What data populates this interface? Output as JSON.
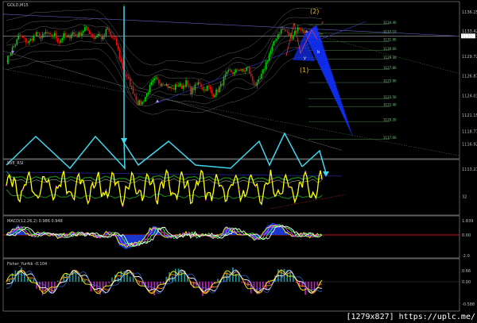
{
  "chart_data": [
    {
      "type": "candlestick",
      "title": "GOLD,M15",
      "ylim": [
        1115.0,
        1137.5
      ],
      "yticks": [
        "1136.25",
        "1133.42",
        "1132.71",
        "1129.72",
        "1126.87",
        "1124.01",
        "1121.15",
        "1118.77",
        "1116.92",
        "1113.27"
      ],
      "ohlc_path": [
        1129.0,
        1130.5,
        1131.5,
        1132.8,
        1132.2,
        1131.7,
        1132.5,
        1133.0,
        1132.4,
        1133.2,
        1132.6,
        1132.9,
        1131.8,
        1132.8,
        1132.2,
        1133.3,
        1132.7,
        1133.1,
        1133.9,
        1133.2,
        1132.4,
        1133.0,
        1132.2,
        1133.8,
        1132.5,
        1131.8,
        1129.2,
        1127.0,
        1126.0,
        1124.5,
        1122.9,
        1123.0,
        1124.2,
        1125.6,
        1126.4,
        1125.8,
        1126.0,
        1125.2,
        1124.9,
        1125.6,
        1125.3,
        1125.9,
        1124.6,
        1125.2,
        1126.0,
        1124.8,
        1125.3,
        1124.1,
        1124.6,
        1125.5,
        1126.9,
        1127.6,
        1127.2,
        1128.0,
        1127.4,
        1128.2,
        1126.3,
        1125.4,
        1126.5,
        1128.3,
        1130.1,
        1131.6,
        1133.0,
        1133.8,
        1133.2,
        1132.5,
        1133.6,
        1133.9,
        1133.1,
        1132.3,
        1133.4,
        1133.0,
        1132.7
      ],
      "marker_labels": [
        "(2)",
        "(1)",
        "a",
        "b",
        "y",
        "x"
      ],
      "series": [
        {
          "name": "bullish",
          "color": "#00d000"
        },
        {
          "name": "bearish",
          "color": "#e01010"
        },
        {
          "name": "zigzag",
          "color": "#40d8f0"
        },
        {
          "name": "harmonic",
          "color": "#1030ff"
        },
        {
          "name": "fib levels",
          "color": "#4a8a4a"
        }
      ]
    },
    {
      "type": "line",
      "title": "SVE_RSI",
      "yticks": [
        "",
        "32"
      ],
      "series": [
        {
          "name": "oscillator",
          "color": "#ffff00"
        }
      ]
    },
    {
      "type": "bar",
      "title": "MACD(12,26,2) 0.986 0.948",
      "yticks": [
        "1.839",
        "0.00",
        "-2.0"
      ],
      "series": [
        {
          "name": "histogram",
          "color": "#1a3ad8"
        },
        {
          "name": "signal",
          "color": "#ff2020"
        }
      ]
    },
    {
      "type": "bar",
      "title": "Fisher_Yur4ik -0.104",
      "yticks": [
        "0.66",
        "0.00",
        "-0.588"
      ],
      "series": [
        {
          "name": "positive",
          "color": "#1e9a9a"
        },
        {
          "name": "negative",
          "color": "#c020c0"
        }
      ]
    }
  ],
  "watermark": "[1279x827] https://uplc.me/"
}
